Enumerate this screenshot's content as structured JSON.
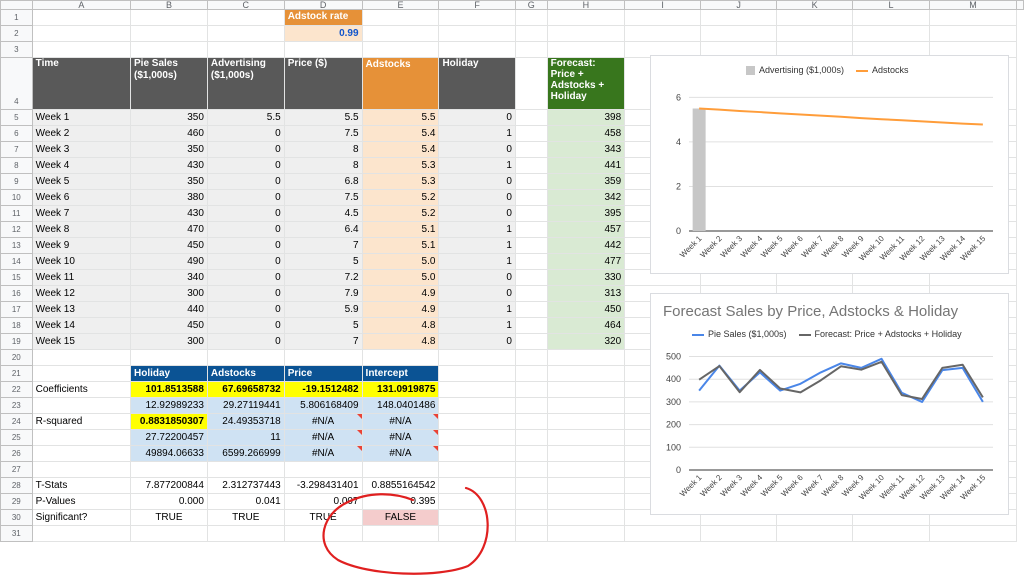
{
  "columns": [
    "A",
    "B",
    "C",
    "D",
    "E",
    "F",
    "G",
    "H",
    "I",
    "J",
    "K",
    "L",
    "M"
  ],
  "adstock": {
    "label": "Adstock rate",
    "value": "0.99"
  },
  "header": {
    "time": "Time",
    "pie_sales": "Pie Sales ($1,000s)",
    "advertising": "Advertising ($1,000s)",
    "price": "Price ($)",
    "adstocks": "Adstocks",
    "holiday": "Holiday",
    "forecast": "Forecast: Price + Adstocks + Holiday"
  },
  "rows": [
    {
      "week": "Week 1",
      "pie": "350",
      "adv": "5.5",
      "price": "5.5",
      "ads": "5.5",
      "hol": "0",
      "fc": "398"
    },
    {
      "week": "Week 2",
      "pie": "460",
      "adv": "0",
      "price": "7.5",
      "ads": "5.4",
      "hol": "1",
      "fc": "458"
    },
    {
      "week": "Week 3",
      "pie": "350",
      "adv": "0",
      "price": "8",
      "ads": "5.4",
      "hol": "0",
      "fc": "343"
    },
    {
      "week": "Week 4",
      "pie": "430",
      "adv": "0",
      "price": "8",
      "ads": "5.3",
      "hol": "1",
      "fc": "441"
    },
    {
      "week": "Week 5",
      "pie": "350",
      "adv": "0",
      "price": "6.8",
      "ads": "5.3",
      "hol": "0",
      "fc": "359"
    },
    {
      "week": "Week 6",
      "pie": "380",
      "adv": "0",
      "price": "7.5",
      "ads": "5.2",
      "hol": "0",
      "fc": "342"
    },
    {
      "week": "Week 7",
      "pie": "430",
      "adv": "0",
      "price": "4.5",
      "ads": "5.2",
      "hol": "0",
      "fc": "395"
    },
    {
      "week": "Week 8",
      "pie": "470",
      "adv": "0",
      "price": "6.4",
      "ads": "5.1",
      "hol": "1",
      "fc": "457"
    },
    {
      "week": "Week 9",
      "pie": "450",
      "adv": "0",
      "price": "7",
      "ads": "5.1",
      "hol": "1",
      "fc": "442"
    },
    {
      "week": "Week 10",
      "pie": "490",
      "adv": "0",
      "price": "5",
      "ads": "5.0",
      "hol": "1",
      "fc": "477"
    },
    {
      "week": "Week 11",
      "pie": "340",
      "adv": "0",
      "price": "7.2",
      "ads": "5.0",
      "hol": "0",
      "fc": "330"
    },
    {
      "week": "Week 12",
      "pie": "300",
      "adv": "0",
      "price": "7.9",
      "ads": "4.9",
      "hol": "0",
      "fc": "313"
    },
    {
      "week": "Week 13",
      "pie": "440",
      "adv": "0",
      "price": "5.9",
      "ads": "4.9",
      "hol": "1",
      "fc": "450"
    },
    {
      "week": "Week 14",
      "pie": "450",
      "adv": "0",
      "price": "5",
      "ads": "4.8",
      "hol": "1",
      "fc": "464"
    },
    {
      "week": "Week 15",
      "pie": "300",
      "adv": "0",
      "price": "7",
      "ads": "4.8",
      "hol": "0",
      "fc": "320"
    }
  ],
  "regression": {
    "headers": [
      "Holiday",
      "Adstocks",
      "Price",
      "Intercept"
    ],
    "coefficients_label": "Coefficients",
    "rsquared_label": "R-squared",
    "r22": [
      "101.8513588",
      "67.69658732",
      "-19.1512482",
      "131.0919875"
    ],
    "r23": [
      "12.92989233",
      "29.27119441",
      "5.806168409",
      "148.0401486"
    ],
    "r24": [
      "0.8831850307",
      "24.49353718",
      "#N/A",
      "#N/A"
    ],
    "r25": [
      "27.72200457",
      "11",
      "#N/A",
      "#N/A"
    ],
    "r26": [
      "49894.06633",
      "6599.266999",
      "#N/A",
      "#N/A"
    ]
  },
  "stats": {
    "tstats_label": "T-Stats",
    "tstats": [
      "7.877200844",
      "2.312737443",
      "-3.298431401",
      "0.8855164542"
    ],
    "pvalues_label": "P-Values",
    "pvalues": [
      "0.000",
      "0.041",
      "0.007",
      "0.395"
    ],
    "significant_label": "Significant?",
    "significant": [
      "TRUE",
      "TRUE",
      "TRUE",
      "FALSE"
    ]
  },
  "chart_data": [
    {
      "type": "bar",
      "title": "",
      "categories": [
        "Week 1",
        "Week 2",
        "Week 3",
        "Week 4",
        "Week 5",
        "Week 6",
        "Week 7",
        "Week 8",
        "Week 9",
        "Week 10",
        "Week 11",
        "Week 12",
        "Week 13",
        "Week 14",
        "Week 15"
      ],
      "series": [
        {
          "name": "Advertising ($1,000s)",
          "kind": "bar",
          "color": "#c7c7c7",
          "values": [
            5.5,
            0,
            0,
            0,
            0,
            0,
            0,
            0,
            0,
            0,
            0,
            0,
            0,
            0,
            0
          ]
        },
        {
          "name": "Adstocks",
          "kind": "line",
          "color": "#ff9d3a",
          "values": [
            5.5,
            5.45,
            5.39,
            5.34,
            5.28,
            5.23,
            5.18,
            5.13,
            5.07,
            5.02,
            4.97,
            4.92,
            4.87,
            4.82,
            4.78
          ]
        }
      ],
      "yticks": [
        0,
        2,
        4,
        6
      ],
      "ylim": [
        0,
        6.6
      ],
      "grid": true,
      "legend": "top"
    },
    {
      "type": "line",
      "title": "Forecast Sales by Price, Adstocks & Holiday",
      "categories": [
        "Week 1",
        "Week 2",
        "Week 3",
        "Week 4",
        "Week 5",
        "Week 6",
        "Week 7",
        "Week 8",
        "Week 9",
        "Week 10",
        "Week 11",
        "Week 12",
        "Week 13",
        "Week 14",
        "Week 15"
      ],
      "series": [
        {
          "name": "Pie Sales ($1,000s)",
          "color": "#4a86e8",
          "values": [
            350,
            460,
            350,
            430,
            350,
            380,
            430,
            470,
            450,
            490,
            340,
            300,
            440,
            450,
            300
          ]
        },
        {
          "name": "Forecast: Price + Adstocks + Holiday",
          "color": "#666666",
          "values": [
            398,
            458,
            343,
            441,
            359,
            342,
            395,
            457,
            442,
            477,
            330,
            313,
            450,
            464,
            320
          ]
        }
      ],
      "yticks": [
        0,
        100,
        200,
        300,
        400,
        500
      ],
      "ylim": [
        0,
        520
      ],
      "grid": true,
      "legend": "top"
    }
  ]
}
